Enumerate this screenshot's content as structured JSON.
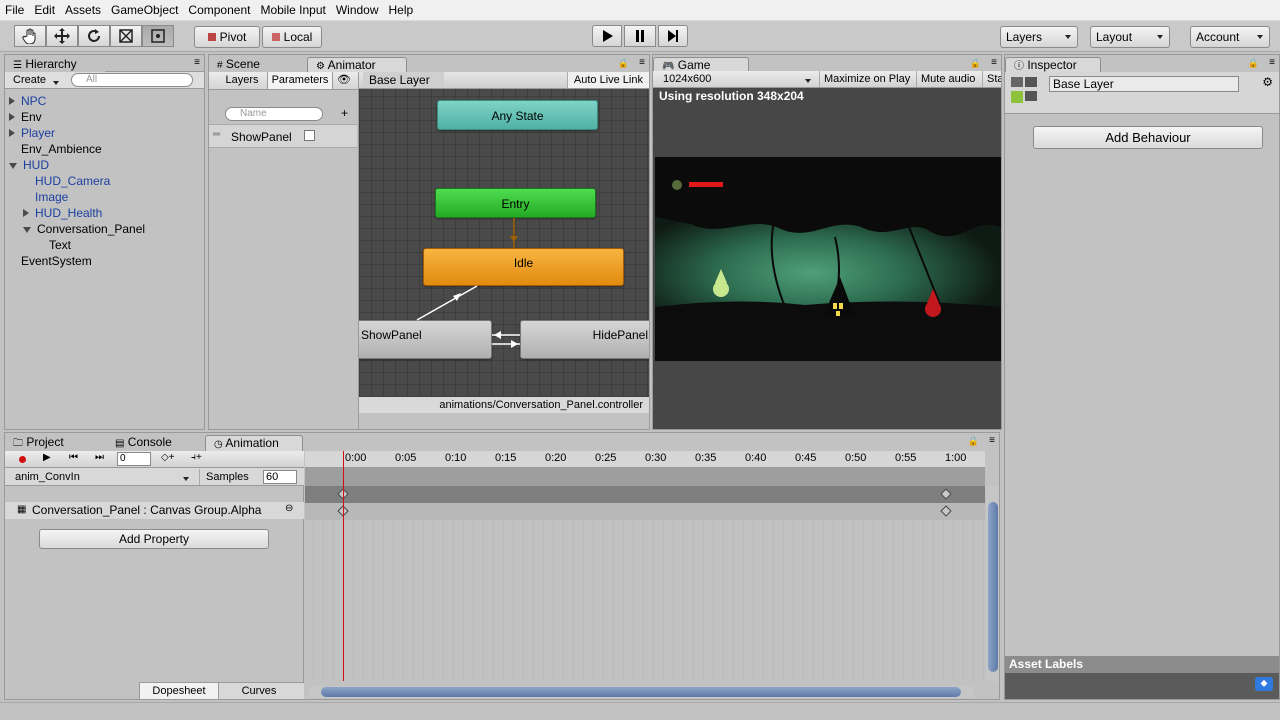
{
  "menu": [
    "File",
    "Edit",
    "Assets",
    "GameObject",
    "Component",
    "Mobile Input",
    "Window",
    "Help"
  ],
  "toolbar": {
    "pivot": "Pivot",
    "local": "Local",
    "layers": "Layers",
    "layout": "Layout",
    "account": "Account"
  },
  "hierarchy": {
    "tab": "Hierarchy",
    "create": "Create",
    "search_placeholder": "All",
    "items": [
      "NPC",
      "Env",
      "Player",
      "Env_Ambience",
      "HUD",
      "HUD_Camera",
      "Image",
      "HUD_Health",
      "Conversation_Panel",
      "Text",
      "EventSystem"
    ]
  },
  "animator": {
    "tab_scene": "Scene",
    "tab_animator": "Animator",
    "sub_layers": "Layers",
    "sub_parameters": "Parameters",
    "search_placeholder": "Name",
    "param_name": "ShowPanel",
    "breadcrumb": "Base Layer",
    "auto_live_link": "Auto Live Link",
    "nodes": {
      "any_state": "Any State",
      "entry": "Entry",
      "idle": "Idle",
      "show_panel": "ShowPanel",
      "hide_panel": "HidePanel"
    },
    "footer_path": "animations/Conversation_Panel.controller"
  },
  "game": {
    "tab": "Game",
    "resolution_select": "1024x600",
    "maximize": "Maximize on Play",
    "mute": "Mute audio",
    "stats": "Sta",
    "resolution_note": "Using resolution 348x204"
  },
  "inspector": {
    "tab": "Inspector",
    "layer_name": "Base Layer",
    "add_behaviour": "Add Behaviour",
    "asset_labels": "Asset Labels"
  },
  "bottom": {
    "tab_project": "Project",
    "tab_console": "Console",
    "tab_animation": "Animation",
    "frame_value": "0",
    "clip_name": "anim_ConvIn",
    "samples_label": "Samples",
    "samples_value": "60",
    "property": "Conversation_Panel : Canvas Group.Alpha",
    "add_property": "Add Property",
    "dopesheet": "Dopesheet",
    "curves": "Curves",
    "timeline": [
      "0:00",
      "0:05",
      "0:10",
      "0:15",
      "0:20",
      "0:25",
      "0:30",
      "0:35",
      "0:40",
      "0:45",
      "0:50",
      "0:55",
      "1:00"
    ]
  },
  "colors": {
    "any_state": "#5ec2b4",
    "entry": "#2fbf2f",
    "idle": "#f0a020",
    "selection_blue": "#1b3fa0"
  }
}
